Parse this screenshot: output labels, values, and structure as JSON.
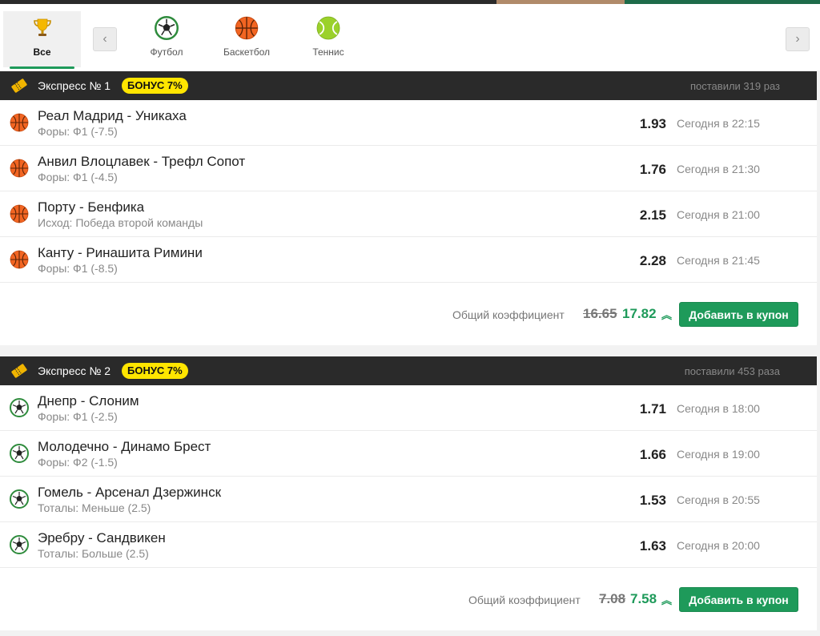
{
  "sports": {
    "tabs": [
      {
        "label": "Все",
        "icon": "trophy-icon"
      },
      {
        "label": "Футбол",
        "icon": "soccer-ball-icon"
      },
      {
        "label": "Баскетбол",
        "icon": "basketball-icon"
      },
      {
        "label": "Теннис",
        "icon": "tennis-ball-icon"
      }
    ],
    "prev": "‹",
    "next": "›"
  },
  "colors": {
    "accent": "#1e9a5a",
    "bonus": "#ffe500",
    "header": "#2a2a2a"
  },
  "expresses": [
    {
      "title": "Экспресс № 1",
      "bonus": "БОНУС 7%",
      "placed": "поставили 319 раз",
      "events": [
        {
          "sport": "basketball-icon",
          "teams": "Реал Мадрид - Уникаха",
          "market": "Форы: Ф1 (-7.5)",
          "odds": "1.93",
          "time": "Сегодня в 22:15"
        },
        {
          "sport": "basketball-icon",
          "teams": "Анвил Влоцлавек - Трефл Сопот",
          "market": "Форы: Ф1 (-4.5)",
          "odds": "1.76",
          "time": "Сегодня в 21:30"
        },
        {
          "sport": "basketball-icon",
          "teams": "Порту - Бенфика",
          "market": "Исход: Победа второй команды",
          "odds": "2.15",
          "time": "Сегодня в 21:00"
        },
        {
          "sport": "basketball-icon",
          "teams": "Канту - Ринашита Римини",
          "market": "Форы: Ф1 (-8.5)",
          "odds": "2.28",
          "time": "Сегодня в 21:45"
        }
      ],
      "total_label": "Общий коэффициент",
      "old_coef": "16.65",
      "new_coef": "17.82",
      "add_label": "Добавить в купон"
    },
    {
      "title": "Экспресс № 2",
      "bonus": "БОНУС 7%",
      "placed": "поставили 453 раза",
      "events": [
        {
          "sport": "soccer-ball-icon",
          "teams": "Днепр - Слоним",
          "market": "Форы: Ф1 (-2.5)",
          "odds": "1.71",
          "time": "Сегодня в 18:00"
        },
        {
          "sport": "soccer-ball-icon",
          "teams": "Молодечно - Динамо Брест",
          "market": "Форы: Ф2 (-1.5)",
          "odds": "1.66",
          "time": "Сегодня в 19:00"
        },
        {
          "sport": "soccer-ball-icon",
          "teams": "Гомель - Арсенал Дзержинск",
          "market": "Тоталы: Меньше (2.5)",
          "odds": "1.53",
          "time": "Сегодня в 20:55"
        },
        {
          "sport": "soccer-ball-icon",
          "teams": "Эребру - Сандвикен",
          "market": "Тоталы: Больше (2.5)",
          "odds": "1.63",
          "time": "Сегодня в 20:00"
        }
      ],
      "total_label": "Общий коэффициент",
      "old_coef": "7.08",
      "new_coef": "7.58",
      "add_label": "Добавить в купон"
    }
  ]
}
